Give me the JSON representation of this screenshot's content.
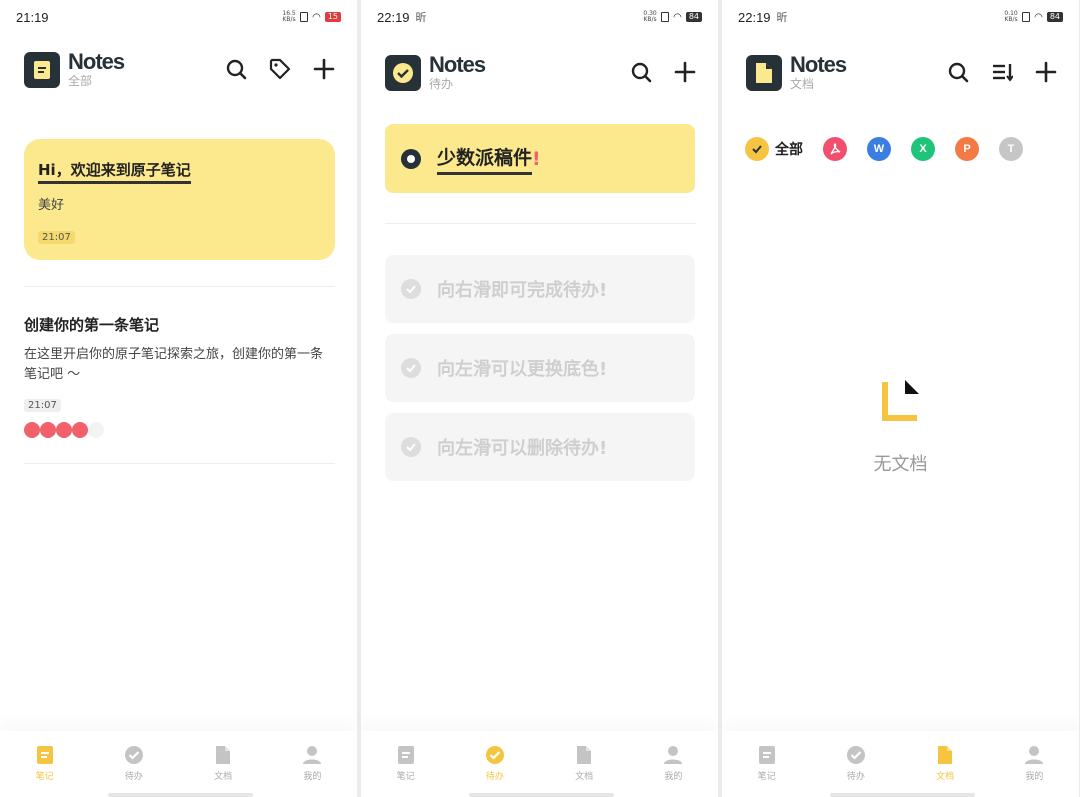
{
  "screens": [
    {
      "status": {
        "time": "21:19",
        "extra": "",
        "net": "16.5 KB/s",
        "battery": "15"
      },
      "header": {
        "title": "Notes",
        "subtitle": "全部"
      },
      "notes": [
        {
          "title": "Hi，欢迎来到原子笔记",
          "body": "美好",
          "time": "21:07"
        },
        {
          "title": "创建你的第一条笔记",
          "body": "在这里开启你的原子笔记探索之旅，创建你的第一条笔记吧 ～",
          "time": "21:07"
        }
      ]
    },
    {
      "status": {
        "time": "22:19",
        "extra": "昕",
        "net": "0.30 KB/s",
        "battery": "84"
      },
      "header": {
        "title": "Notes",
        "subtitle": "待办"
      },
      "pinned_todo": {
        "text": "少数派稿件",
        "mark": "!"
      },
      "hints": [
        "向右滑即可完成待办!",
        "向左滑可以更换底色!",
        "向左滑可以删除待办!"
      ]
    },
    {
      "status": {
        "time": "22:19",
        "extra": "昕",
        "net": "0.10 KB/s",
        "battery": "84"
      },
      "header": {
        "title": "Notes",
        "subtitle": "文档"
      },
      "filters": [
        {
          "label": "全部",
          "icon": "check-icon",
          "color": "#f5c542"
        },
        {
          "label": "",
          "icon": "pdf-icon",
          "color": "#f0506e"
        },
        {
          "label": "W",
          "icon": "word-icon",
          "color": "#3b7de0"
        },
        {
          "label": "X",
          "icon": "excel-icon",
          "color": "#1fc47a"
        },
        {
          "label": "P",
          "icon": "ppt-icon",
          "color": "#f47a45"
        },
        {
          "label": "T",
          "icon": "text-icon",
          "color": "#c6c6c6"
        }
      ],
      "empty_text": "无文档"
    }
  ],
  "tabs": [
    "笔记",
    "待办",
    "文档",
    "我的"
  ],
  "active_tabs": [
    0,
    1,
    2
  ],
  "colors": {
    "accent": "#f5c542",
    "card": "#fce98e",
    "dark": "#263238",
    "dot": "#f2616b"
  }
}
